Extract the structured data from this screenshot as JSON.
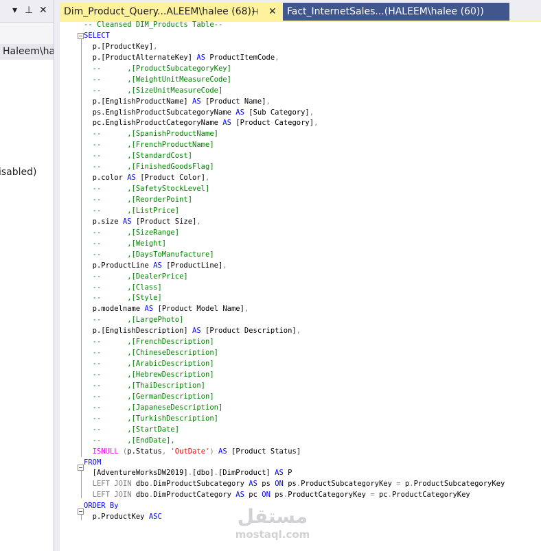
{
  "left_panel": {
    "icons": [
      "chevron-down-icon",
      "pin-icon",
      "close-icon"
    ],
    "user_item": "Haleem\\ha",
    "status_fragment": "isabled)"
  },
  "tabs": [
    {
      "label": "Dim_Product_Query...ALEEM\\halee (68))",
      "active": true
    },
    {
      "label": "Fact_InternetSales...(HALEEM\\halee (60))",
      "active": false
    }
  ],
  "editor": {
    "lines": [
      [
        {
          "t": "-- Cleansed DIM_Products Table--",
          "c": "cm"
        }
      ],
      [
        {
          "t": "SELECT",
          "c": "kw"
        }
      ],
      [
        {
          "t": "  p.[ProductKey]",
          "c": ""
        },
        {
          "t": ",",
          "c": "op"
        }
      ],
      [
        {
          "t": "  p.[ProductAlternateKey] ",
          "c": ""
        },
        {
          "t": "AS",
          "c": "kw"
        },
        {
          "t": " ProductItemCode",
          "c": ""
        },
        {
          "t": ",",
          "c": "op"
        }
      ],
      [
        {
          "t": "  --      ,[ProductSubcategoryKey]",
          "c": "cm"
        }
      ],
      [
        {
          "t": "  --      ,[WeightUnitMeasureCode]",
          "c": "cm"
        }
      ],
      [
        {
          "t": "  --      ,[SizeUnitMeasureCode]",
          "c": "cm"
        }
      ],
      [
        {
          "t": "  p.[EnglishProductName] ",
          "c": ""
        },
        {
          "t": "AS",
          "c": "kw"
        },
        {
          "t": " [Product Name]",
          "c": ""
        },
        {
          "t": ",",
          "c": "op"
        }
      ],
      [
        {
          "t": "  ps.EnglishProductSubcategoryName ",
          "c": ""
        },
        {
          "t": "AS",
          "c": "kw"
        },
        {
          "t": " [Sub Category]",
          "c": ""
        },
        {
          "t": ",",
          "c": "op"
        }
      ],
      [
        {
          "t": "  pc.EnglishProductCategoryName ",
          "c": ""
        },
        {
          "t": "AS",
          "c": "kw"
        },
        {
          "t": " [Product Category]",
          "c": ""
        },
        {
          "t": ",",
          "c": "op"
        }
      ],
      [
        {
          "t": "  --      ,[SpanishProductName]",
          "c": "cm"
        }
      ],
      [
        {
          "t": "  --      ,[FrenchProductName]",
          "c": "cm"
        }
      ],
      [
        {
          "t": "  --      ,[StandardCost]",
          "c": "cm"
        }
      ],
      [
        {
          "t": "  --      ,[FinishedGoodsFlag]",
          "c": "cm"
        }
      ],
      [
        {
          "t": "  p.color ",
          "c": ""
        },
        {
          "t": "AS",
          "c": "kw"
        },
        {
          "t": " [Product Color]",
          "c": ""
        },
        {
          "t": ",",
          "c": "op"
        }
      ],
      [
        {
          "t": "  --      ,[SafetyStockLevel]",
          "c": "cm"
        }
      ],
      [
        {
          "t": "  --      ,[ReorderPoint]",
          "c": "cm"
        }
      ],
      [
        {
          "t": "  --      ,[ListPrice]",
          "c": "cm"
        }
      ],
      [
        {
          "t": "  p.size ",
          "c": ""
        },
        {
          "t": "AS",
          "c": "kw"
        },
        {
          "t": " [Product Size]",
          "c": ""
        },
        {
          "t": ",",
          "c": "op"
        }
      ],
      [
        {
          "t": "  --      ,[SizeRange]",
          "c": "cm"
        }
      ],
      [
        {
          "t": "  --      ,[Weight]",
          "c": "cm"
        }
      ],
      [
        {
          "t": "  --      ,[DaysToManufacture]",
          "c": "cm"
        }
      ],
      [
        {
          "t": "  p.ProductLine ",
          "c": ""
        },
        {
          "t": "AS",
          "c": "kw"
        },
        {
          "t": " [ProductLine]",
          "c": ""
        },
        {
          "t": ",",
          "c": "op"
        }
      ],
      [
        {
          "t": "  --      ,[DealerPrice]",
          "c": "cm"
        }
      ],
      [
        {
          "t": "  --      ,[Class]",
          "c": "cm"
        }
      ],
      [
        {
          "t": "  --      ,[Style]",
          "c": "cm"
        }
      ],
      [
        {
          "t": "  p.modelname ",
          "c": ""
        },
        {
          "t": "AS",
          "c": "kw"
        },
        {
          "t": " [Product Model Name]",
          "c": ""
        },
        {
          "t": ",",
          "c": "op"
        }
      ],
      [
        {
          "t": "  --      ,[LargePhoto]",
          "c": "cm"
        }
      ],
      [
        {
          "t": "  p.[EnglishDescription] ",
          "c": ""
        },
        {
          "t": "AS",
          "c": "kw"
        },
        {
          "t": " [Product Description]",
          "c": ""
        },
        {
          "t": ",",
          "c": "op"
        }
      ],
      [
        {
          "t": "  --      ,[FrenchDescription]",
          "c": "cm"
        }
      ],
      [
        {
          "t": "  --      ,[ChineseDescription]",
          "c": "cm"
        }
      ],
      [
        {
          "t": "  --      ,[ArabicDescription]",
          "c": "cm"
        }
      ],
      [
        {
          "t": "  --      ,[HebrewDescription]",
          "c": "cm"
        }
      ],
      [
        {
          "t": "  --      ,[ThaiDescription]",
          "c": "cm"
        }
      ],
      [
        {
          "t": "  --      ,[GermanDescription]",
          "c": "cm"
        }
      ],
      [
        {
          "t": "  --      ,[JapaneseDescription]",
          "c": "cm"
        }
      ],
      [
        {
          "t": "  --      ,[TurkishDescription]",
          "c": "cm"
        }
      ],
      [
        {
          "t": "  --      ,[StartDate]",
          "c": "cm"
        }
      ],
      [
        {
          "t": "  --      ,[EndDate],",
          "c": "cm"
        }
      ],
      [
        {
          "t": "  ",
          "c": ""
        },
        {
          "t": "ISNULL",
          "c": "fn"
        },
        {
          "t": " ",
          "c": ""
        },
        {
          "t": "(",
          "c": "op"
        },
        {
          "t": "p.Status",
          "c": ""
        },
        {
          "t": ",",
          "c": "op"
        },
        {
          "t": " ",
          "c": ""
        },
        {
          "t": "'OutDate'",
          "c": "str"
        },
        {
          "t": ")",
          "c": "op"
        },
        {
          "t": " ",
          "c": ""
        },
        {
          "t": "AS",
          "c": "kw"
        },
        {
          "t": " [Product Status]",
          "c": ""
        }
      ],
      [
        {
          "t": "FROM",
          "c": "kw"
        }
      ],
      [
        {
          "t": "  [AdventureWorksDW2019]",
          "c": ""
        },
        {
          "t": ".",
          "c": "op"
        },
        {
          "t": "[dbo]",
          "c": ""
        },
        {
          "t": ".",
          "c": "op"
        },
        {
          "t": "[DimProduct] ",
          "c": ""
        },
        {
          "t": "AS",
          "c": "kw"
        },
        {
          "t": " P",
          "c": ""
        }
      ],
      [
        {
          "t": "  ",
          "c": ""
        },
        {
          "t": "LEFT JOIN",
          "c": "op"
        },
        {
          "t": " dbo",
          "c": ""
        },
        {
          "t": ".",
          "c": "op"
        },
        {
          "t": "DimProductSubcategory ",
          "c": ""
        },
        {
          "t": "AS",
          "c": "kw"
        },
        {
          "t": " ps ",
          "c": ""
        },
        {
          "t": "ON",
          "c": "kw"
        },
        {
          "t": " ps",
          "c": ""
        },
        {
          "t": ".",
          "c": "op"
        },
        {
          "t": "ProductSubcategoryKey ",
          "c": ""
        },
        {
          "t": "=",
          "c": "op"
        },
        {
          "t": " p",
          "c": ""
        },
        {
          "t": ".",
          "c": "op"
        },
        {
          "t": "ProductSubcategoryKey",
          "c": ""
        }
      ],
      [
        {
          "t": "  ",
          "c": ""
        },
        {
          "t": "LEFT JOIN",
          "c": "op"
        },
        {
          "t": " dbo",
          "c": ""
        },
        {
          "t": ".",
          "c": "op"
        },
        {
          "t": "DimProductCategory ",
          "c": ""
        },
        {
          "t": "AS",
          "c": "kw"
        },
        {
          "t": " pc ",
          "c": ""
        },
        {
          "t": "ON",
          "c": "kw"
        },
        {
          "t": " ps",
          "c": ""
        },
        {
          "t": ".",
          "c": "op"
        },
        {
          "t": "ProductCategoryKey ",
          "c": ""
        },
        {
          "t": "=",
          "c": "op"
        },
        {
          "t": " pc",
          "c": ""
        },
        {
          "t": ".",
          "c": "op"
        },
        {
          "t": "ProductCategoryKey",
          "c": ""
        }
      ],
      [
        {
          "t": "ORDER By",
          "c": "kw"
        }
      ],
      [
        {
          "t": "  p.ProductKey ",
          "c": ""
        },
        {
          "t": "ASC",
          "c": "kw"
        }
      ]
    ]
  },
  "watermark": {
    "arabic": "مستقل",
    "latin": "mostaql.com"
  },
  "colors": {
    "keyword": "#0000ff",
    "comment": "#008000",
    "function": "#ff00ff",
    "string": "#ff0000",
    "operator": "#808080",
    "active_tab": "#fff29d",
    "inactive_tab": "#40568d"
  }
}
